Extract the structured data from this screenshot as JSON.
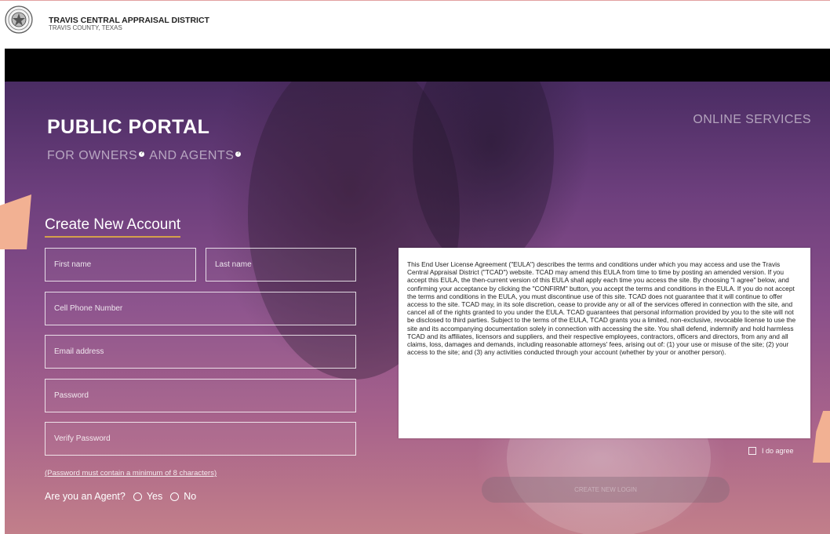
{
  "header": {
    "org_name": "TRAVIS CENTRAL APPRAISAL DISTRICT",
    "org_sub": "TRAVIS COUNTY, TEXAS"
  },
  "hero": {
    "title": "PUBLIC PORTAL",
    "subtitle_part1": "FOR OWNERS",
    "subtitle_part2": " AND AGENTS",
    "help_glyph": "?",
    "online_services": "ONLINE SERVICES"
  },
  "form": {
    "title": "Create New Account",
    "first_name_placeholder": "First name",
    "last_name_placeholder": "Last name",
    "phone_placeholder": "Cell Phone Number",
    "email_placeholder": "Email address",
    "password_placeholder": "Password",
    "verify_password_placeholder": "Verify Password",
    "password_note": "(Password must contain a minimum of 8 characters)",
    "agent_question": "Are you an Agent?",
    "yes_label": "Yes",
    "no_label": "No"
  },
  "eula": {
    "text": "This End User License Agreement (\"EULA\") describes the terms and conditions under which you may access and use the Travis Central Appraisal District (\"TCAD\") website.  TCAD may amend this EULA from time to time by posting an amended version.  If you accept this EULA, the then-current version of this EULA shall apply each time you access the site.  By choosing \"I agree\" below, and confirming your acceptance by clicking the \"CONFIRM\" button, you accept the terms and conditions in the EULA.  If you do not accept the terms and conditions in the EULA, you must discontinue use of this site.  TCAD does not guarantee that it will continue to offer access to the site.  TCAD may, in its sole discretion, cease to provide any or all of the services offered in connection with the site, and cancel all of the rights granted to you under the EULA.  TCAD guarantees that personal information provided by you to the site will not be disclosed to third parties.  Subject to the terms of the EULA, TCAD grants you a limited, non-exclusive, revocable license to use the site and its accompanying documentation solely in connection with accessing the site.  You shall defend, indemnify and hold harmless TCAD and its affiliates, licensors and suppliers, and their respective employees, contractors, officers and directors, from any and all claims, loss, damages and demands, including reasonable attorneys' fees, arising out of: (1) your use or misuse of the site; (2) your access to the site; and (3) any activities conducted through your account (whether by your or another person).",
    "agree_label": "I do agree",
    "agree_checked": false
  },
  "actions": {
    "create_login_label": "CREATE NEW LOGIN"
  },
  "colors": {
    "accent_underline": "#d4a04a",
    "annotation_peach": "#f2b193"
  }
}
